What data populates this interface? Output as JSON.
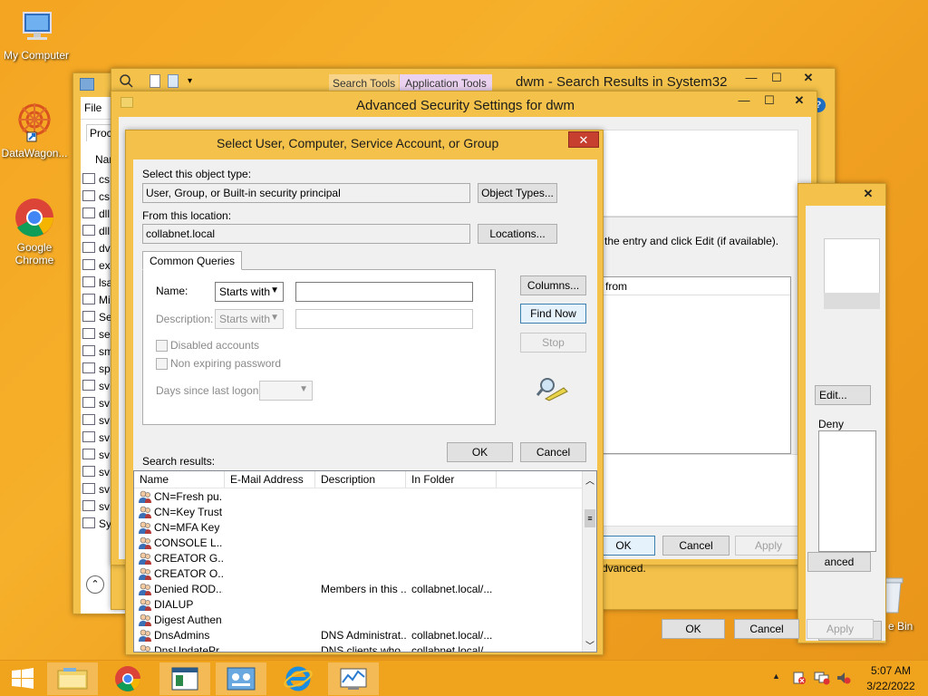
{
  "desktop": {
    "icons": [
      {
        "label": "My Computer"
      },
      {
        "label": "DataWagon..."
      },
      {
        "label": "Google Chrome"
      }
    ],
    "recycle_fragment": "e Bin"
  },
  "explorer": {
    "title": "dwm - Search Results in System32",
    "ribbon_tabs": [
      "Search Tools",
      "Application Tools"
    ]
  },
  "bg_window": {
    "menu_file": "File",
    "tab_fragment": "Proce",
    "col_fragment": "Nam",
    "items": [
      "cs",
      "cs",
      "dll",
      "dll",
      "dv",
      "ex",
      "lsa",
      "Mi",
      "Se",
      "se",
      "sm",
      "sp",
      "sv",
      "sv",
      "sv",
      "sv",
      "sv",
      "sv",
      "sv",
      "sv",
      "Sy"
    ]
  },
  "advsec": {
    "title": "Advanced Security Settings for dwm",
    "partial_text": "the entry and click Edit (if available).",
    "col_fragment": "d from",
    "ok": "OK",
    "cancel": "Cancel",
    "apply": "Apply"
  },
  "perm": {
    "edit": "Edit...",
    "deny": "Deny",
    "advanced": "anced",
    "advanced_text": "dvanced.",
    "ok": "OK",
    "cancel": "Cancel",
    "apply": "Apply"
  },
  "dialog": {
    "title": "Select User, Computer, Service Account, or Group",
    "object_type_label": "Select this object type:",
    "object_type_value": "User, Group, or Built-in security principal",
    "object_types_btn": "Object Types...",
    "location_label": "From this location:",
    "location_value": "collabnet.local",
    "locations_btn": "Locations...",
    "tab": "Common Queries",
    "name_label": "Name:",
    "name_mode": "Starts with",
    "desc_label": "Description:",
    "desc_mode": "Starts with",
    "disabled_accounts": "Disabled accounts",
    "non_expiring": "Non expiring password",
    "days_label": "Days since last logon:",
    "columns_btn": "Columns...",
    "find_now_btn": "Find Now",
    "stop_btn": "Stop",
    "ok": "OK",
    "cancel": "Cancel",
    "results_label": "Search results:",
    "columns": [
      "Name",
      "E-Mail Address",
      "Description",
      "In Folder"
    ],
    "rows": [
      {
        "name": "CN=Fresh pu...",
        "email": "",
        "desc": "",
        "folder": ""
      },
      {
        "name": "CN=Key Trust",
        "email": "",
        "desc": "",
        "folder": ""
      },
      {
        "name": "CN=MFA Key ...",
        "email": "",
        "desc": "",
        "folder": ""
      },
      {
        "name": "CONSOLE L...",
        "email": "",
        "desc": "",
        "folder": ""
      },
      {
        "name": "CREATOR G...",
        "email": "",
        "desc": "",
        "folder": ""
      },
      {
        "name": "CREATOR O...",
        "email": "",
        "desc": "",
        "folder": ""
      },
      {
        "name": "Denied ROD...",
        "email": "",
        "desc": "Members in this ...",
        "folder": "collabnet.local/..."
      },
      {
        "name": "DIALUP",
        "email": "",
        "desc": "",
        "folder": ""
      },
      {
        "name": "Digest Authen...",
        "email": "",
        "desc": "",
        "folder": ""
      },
      {
        "name": "DnsAdmins",
        "email": "",
        "desc": "DNS Administrat...",
        "folder": "collabnet.local/..."
      },
      {
        "name": "DnsUpdatePr...",
        "email": "",
        "desc": "DNS clients who ...",
        "folder": "collabnet.local/..."
      }
    ]
  },
  "taskbar": {
    "time": "5:07 AM",
    "date": "3/22/2022"
  },
  "colors": {
    "desktop": "#f4a522",
    "window_frame": "#f4c24a",
    "close_red": "#c7402f",
    "taskbar": "#f0a31c"
  }
}
